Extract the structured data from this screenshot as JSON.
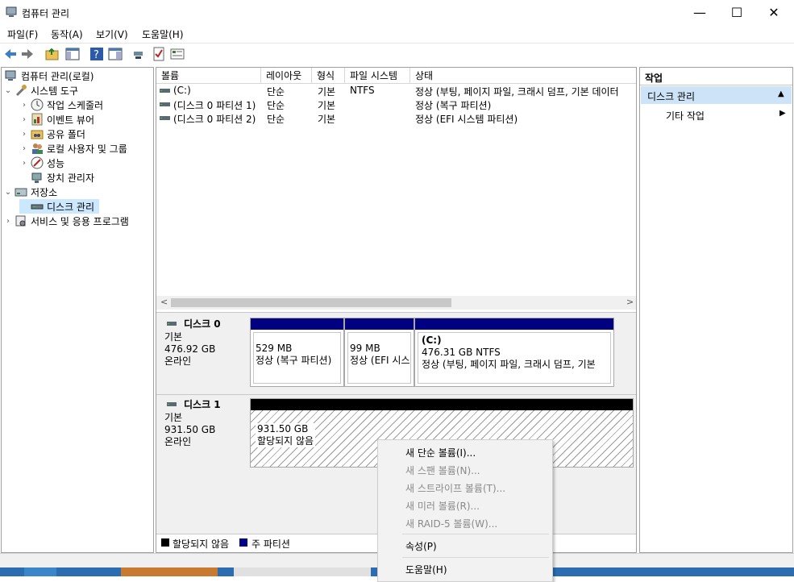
{
  "window": {
    "title": "컴퓨터 관리",
    "minimize": "—",
    "maximize": "☐",
    "close": "✕"
  },
  "menu": [
    "파일(F)",
    "동작(A)",
    "보기(V)",
    "도움말(H)"
  ],
  "tree": {
    "root": "컴퓨터 관리(로컬)",
    "system_tools": "시스템 도구",
    "task_scheduler": "작업 스케줄러",
    "event_viewer": "이벤트 뷰어",
    "shared_folders": "공유 폴더",
    "local_users": "로컬 사용자 및 그룹",
    "performance": "성능",
    "device_manager": "장치 관리자",
    "storage": "저장소",
    "disk_management": "디스크 관리",
    "services": "서비스 및 응용 프로그램"
  },
  "volume_list": {
    "columns": [
      "볼륨",
      "레이아웃",
      "형식",
      "파일 시스템",
      "상태"
    ],
    "rows": [
      {
        "volume": "(C:)",
        "layout": "단순",
        "type": "기본",
        "fs": "NTFS",
        "status": "정상 (부팅, 페이지 파일, 크래시 덤프, 기본 데이터"
      },
      {
        "volume": "(디스크 0 파티션 1)",
        "layout": "단순",
        "type": "기본",
        "fs": "",
        "status": "정상 (복구 파티션)"
      },
      {
        "volume": "(디스크 0 파티션 2)",
        "layout": "단순",
        "type": "기본",
        "fs": "",
        "status": "정상 (EFI 시스템 파티션)"
      }
    ]
  },
  "disks": [
    {
      "name": "디스크 0",
      "kind": "기본",
      "size": "476.92 GB",
      "state": "온라인",
      "partitions": [
        {
          "title": "",
          "size": "529 MB",
          "status": "정상 (복구 파티션)"
        },
        {
          "title": "",
          "size": "99 MB",
          "status": "정상 (EFI 시스"
        },
        {
          "title": "(C:)",
          "size": "476.31 GB NTFS",
          "status": "정상 (부팅, 페이지 파일, 크래시 덤프, 기본"
        }
      ]
    },
    {
      "name": "디스크 1",
      "kind": "기본",
      "size": "931.50 GB",
      "state": "온라인",
      "partitions": [
        {
          "title": "",
          "size": "931.50 GB",
          "status": "할당되지 않음"
        }
      ]
    }
  ],
  "legend": {
    "unallocated": "할당되지 않음",
    "primary": "주 파티션"
  },
  "actions": {
    "header": "작업",
    "section": "디스크 관리",
    "more": "기타 작업"
  },
  "context_menu": {
    "new_simple": "새 단순 볼륨(I)...",
    "new_spanned": "새 스팬 볼륨(N)...",
    "new_striped": "새 스트라이프 볼륨(T)...",
    "new_mirror": "새 미러 볼륨(R)...",
    "new_raid5": "새 RAID-5 볼륨(W)...",
    "properties": "속성(P)",
    "help": "도움말(H)"
  },
  "colors": {
    "primary_partition": "#000080",
    "unallocated": "#000000",
    "action_section_bg": "#cde3f7"
  }
}
